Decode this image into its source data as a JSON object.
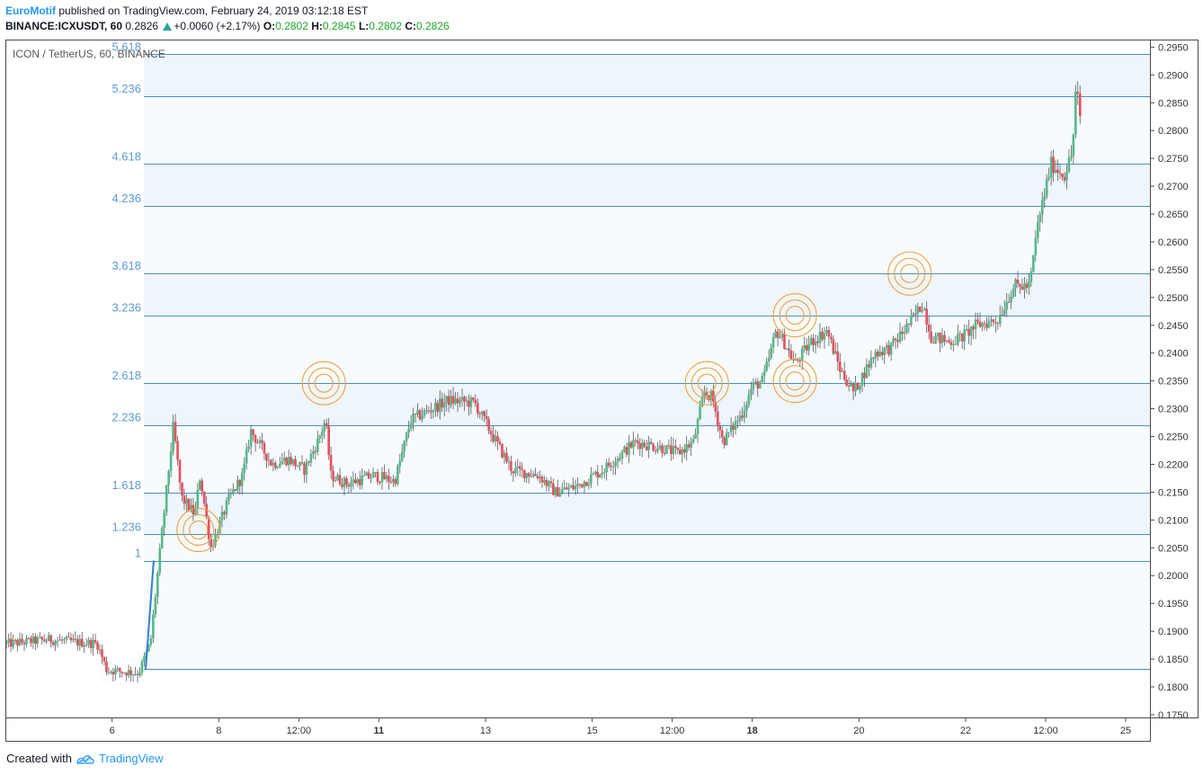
{
  "header": {
    "author": "EuroMotif",
    "published_text": "published on TradingView.com, February 24, 2019 03:12:18 EST",
    "symbol": "BINANCE:ICXUSDT, 60",
    "last": "0.2826",
    "change": "+0.0060 (+2.17%)",
    "o_label": "O:",
    "o_value": "0.2802",
    "h_label": "H:",
    "h_value": "0.2845",
    "l_label": "L:",
    "l_value": "0.2802",
    "c_label": "C:",
    "c_value": "0.2826"
  },
  "footer": {
    "created_with": "Created with",
    "brand": "TradingView",
    "logo_icon": "tradingview-logo-icon"
  },
  "colors": {
    "up": "#53b987",
    "down": "#eb4d5c",
    "fib_line": "#4a90c0",
    "fib_text": "#5b9bd5",
    "band": "#eef5fb",
    "circle": "#f0a03c",
    "trend": "#2f7fd1"
  },
  "chart_data": {
    "type": "candlestick",
    "title": "ICON / TetherUS, 60, BINANCE",
    "y_ticks": [
      "0.2950",
      "0.2900",
      "0.2850",
      "0.2800",
      "0.2750",
      "0.2700",
      "0.2650",
      "0.2600",
      "0.2550",
      "0.2500",
      "0.2450",
      "0.2400",
      "0.2350",
      "0.2300",
      "0.2250",
      "0.2200",
      "0.2150",
      "0.2100",
      "0.2050",
      "0.2000",
      "0.1950",
      "0.1900",
      "0.1850",
      "0.1800",
      "0.1750"
    ],
    "ylim": [
      0.1745,
      0.2962
    ],
    "x_ticks": [
      {
        "label": "6",
        "day": 6,
        "bold": false
      },
      {
        "label": "8",
        "day": 8,
        "bold": false
      },
      {
        "label": "12:00",
        "day": 9.5,
        "bold": false
      },
      {
        "label": "11",
        "day": 11,
        "bold": true
      },
      {
        "label": "13",
        "day": 13,
        "bold": false
      },
      {
        "label": "15",
        "day": 15,
        "bold": false
      },
      {
        "label": "12:00",
        "day": 16.5,
        "bold": false
      },
      {
        "label": "18",
        "day": 18,
        "bold": true
      },
      {
        "label": "20",
        "day": 20,
        "bold": false
      },
      {
        "label": "22",
        "day": 22,
        "bold": false
      },
      {
        "label": "12:00",
        "day": 23.5,
        "bold": false
      },
      {
        "label": "25",
        "day": 25,
        "bold": false
      }
    ],
    "fib_extension": {
      "levels": [
        {
          "ratio": "1",
          "price": 0.2027
        },
        {
          "ratio": "1.236",
          "price": 0.2074
        },
        {
          "ratio": "1.618",
          "price": 0.2149
        },
        {
          "ratio": "2.236",
          "price": 0.2271
        },
        {
          "ratio": "2.618",
          "price": 0.2346
        },
        {
          "ratio": "3.236",
          "price": 0.2468
        },
        {
          "ratio": "3.618",
          "price": 0.2543
        },
        {
          "ratio": "4.236",
          "price": 0.2665
        },
        {
          "ratio": "4.618",
          "price": 0.274
        },
        {
          "ratio": "5.236",
          "price": 0.2862
        },
        {
          "ratio": "5.618",
          "price": 0.2937
        }
      ],
      "base_price": 0.1832,
      "trend_line": [
        {
          "day": 6.63,
          "price": 0.1832
        },
        {
          "day": 6.78,
          "price": 0.2027
        }
      ]
    },
    "series_path": [
      {
        "day": 4.0,
        "price": 0.1877
      },
      {
        "day": 4.8,
        "price": 0.1885
      },
      {
        "day": 5.35,
        "price": 0.188
      },
      {
        "day": 5.72,
        "price": 0.1878
      },
      {
        "day": 5.9,
        "price": 0.183
      },
      {
        "day": 6.5,
        "price": 0.1825
      },
      {
        "day": 6.72,
        "price": 0.188
      },
      {
        "day": 6.85,
        "price": 0.2
      },
      {
        "day": 7.15,
        "price": 0.227
      },
      {
        "day": 7.3,
        "price": 0.214
      },
      {
        "day": 7.55,
        "price": 0.211
      },
      {
        "day": 7.65,
        "price": 0.218
      },
      {
        "day": 7.85,
        "price": 0.205
      },
      {
        "day": 8.2,
        "price": 0.214
      },
      {
        "day": 8.45,
        "price": 0.218
      },
      {
        "day": 8.6,
        "price": 0.226
      },
      {
        "day": 9.0,
        "price": 0.22
      },
      {
        "day": 9.3,
        "price": 0.221
      },
      {
        "day": 9.6,
        "price": 0.219
      },
      {
        "day": 9.85,
        "price": 0.224
      },
      {
        "day": 10.0,
        "price": 0.228
      },
      {
        "day": 10.1,
        "price": 0.218
      },
      {
        "day": 10.4,
        "price": 0.2165
      },
      {
        "day": 10.9,
        "price": 0.218
      },
      {
        "day": 11.3,
        "price": 0.217
      },
      {
        "day": 11.6,
        "price": 0.228
      },
      {
        "day": 12.0,
        "price": 0.23
      },
      {
        "day": 12.3,
        "price": 0.2315
      },
      {
        "day": 12.8,
        "price": 0.231
      },
      {
        "day": 13.2,
        "price": 0.224
      },
      {
        "day": 13.5,
        "price": 0.219
      },
      {
        "day": 14.0,
        "price": 0.218
      },
      {
        "day": 14.3,
        "price": 0.215
      },
      {
        "day": 14.7,
        "price": 0.216
      },
      {
        "day": 15.2,
        "price": 0.219
      },
      {
        "day": 15.8,
        "price": 0.224
      },
      {
        "day": 16.3,
        "price": 0.223
      },
      {
        "day": 16.6,
        "price": 0.222
      },
      {
        "day": 16.9,
        "price": 0.224
      },
      {
        "day": 17.1,
        "price": 0.233
      },
      {
        "day": 17.25,
        "price": 0.232
      },
      {
        "day": 17.45,
        "price": 0.224
      },
      {
        "day": 17.8,
        "price": 0.229
      },
      {
        "day": 18.0,
        "price": 0.234
      },
      {
        "day": 18.2,
        "price": 0.235
      },
      {
        "day": 18.45,
        "price": 0.244
      },
      {
        "day": 18.6,
        "price": 0.242
      },
      {
        "day": 18.8,
        "price": 0.238
      },
      {
        "day": 19.1,
        "price": 0.242
      },
      {
        "day": 19.4,
        "price": 0.244
      },
      {
        "day": 19.65,
        "price": 0.237
      },
      {
        "day": 19.9,
        "price": 0.233
      },
      {
        "day": 20.3,
        "price": 0.24
      },
      {
        "day": 20.6,
        "price": 0.241
      },
      {
        "day": 21.0,
        "price": 0.246
      },
      {
        "day": 21.2,
        "price": 0.249
      },
      {
        "day": 21.35,
        "price": 0.243
      },
      {
        "day": 21.7,
        "price": 0.242
      },
      {
        "day": 21.95,
        "price": 0.243
      },
      {
        "day": 22.2,
        "price": 0.245
      },
      {
        "day": 22.6,
        "price": 0.246
      },
      {
        "day": 22.9,
        "price": 0.252
      },
      {
        "day": 23.2,
        "price": 0.252
      },
      {
        "day": 23.35,
        "price": 0.263
      },
      {
        "day": 23.6,
        "price": 0.274
      },
      {
        "day": 23.85,
        "price": 0.272
      },
      {
        "day": 24.0,
        "price": 0.276
      },
      {
        "day": 24.07,
        "price": 0.288
      },
      {
        "day": 24.15,
        "price": 0.2826
      }
    ],
    "circles": [
      {
        "day": 7.62,
        "price": 0.2082
      },
      {
        "day": 9.97,
        "price": 0.2346
      },
      {
        "day": 17.15,
        "price": 0.2346
      },
      {
        "day": 18.8,
        "price": 0.2468
      },
      {
        "day": 18.8,
        "price": 0.235
      },
      {
        "day": 20.95,
        "price": 0.2543
      }
    ]
  }
}
